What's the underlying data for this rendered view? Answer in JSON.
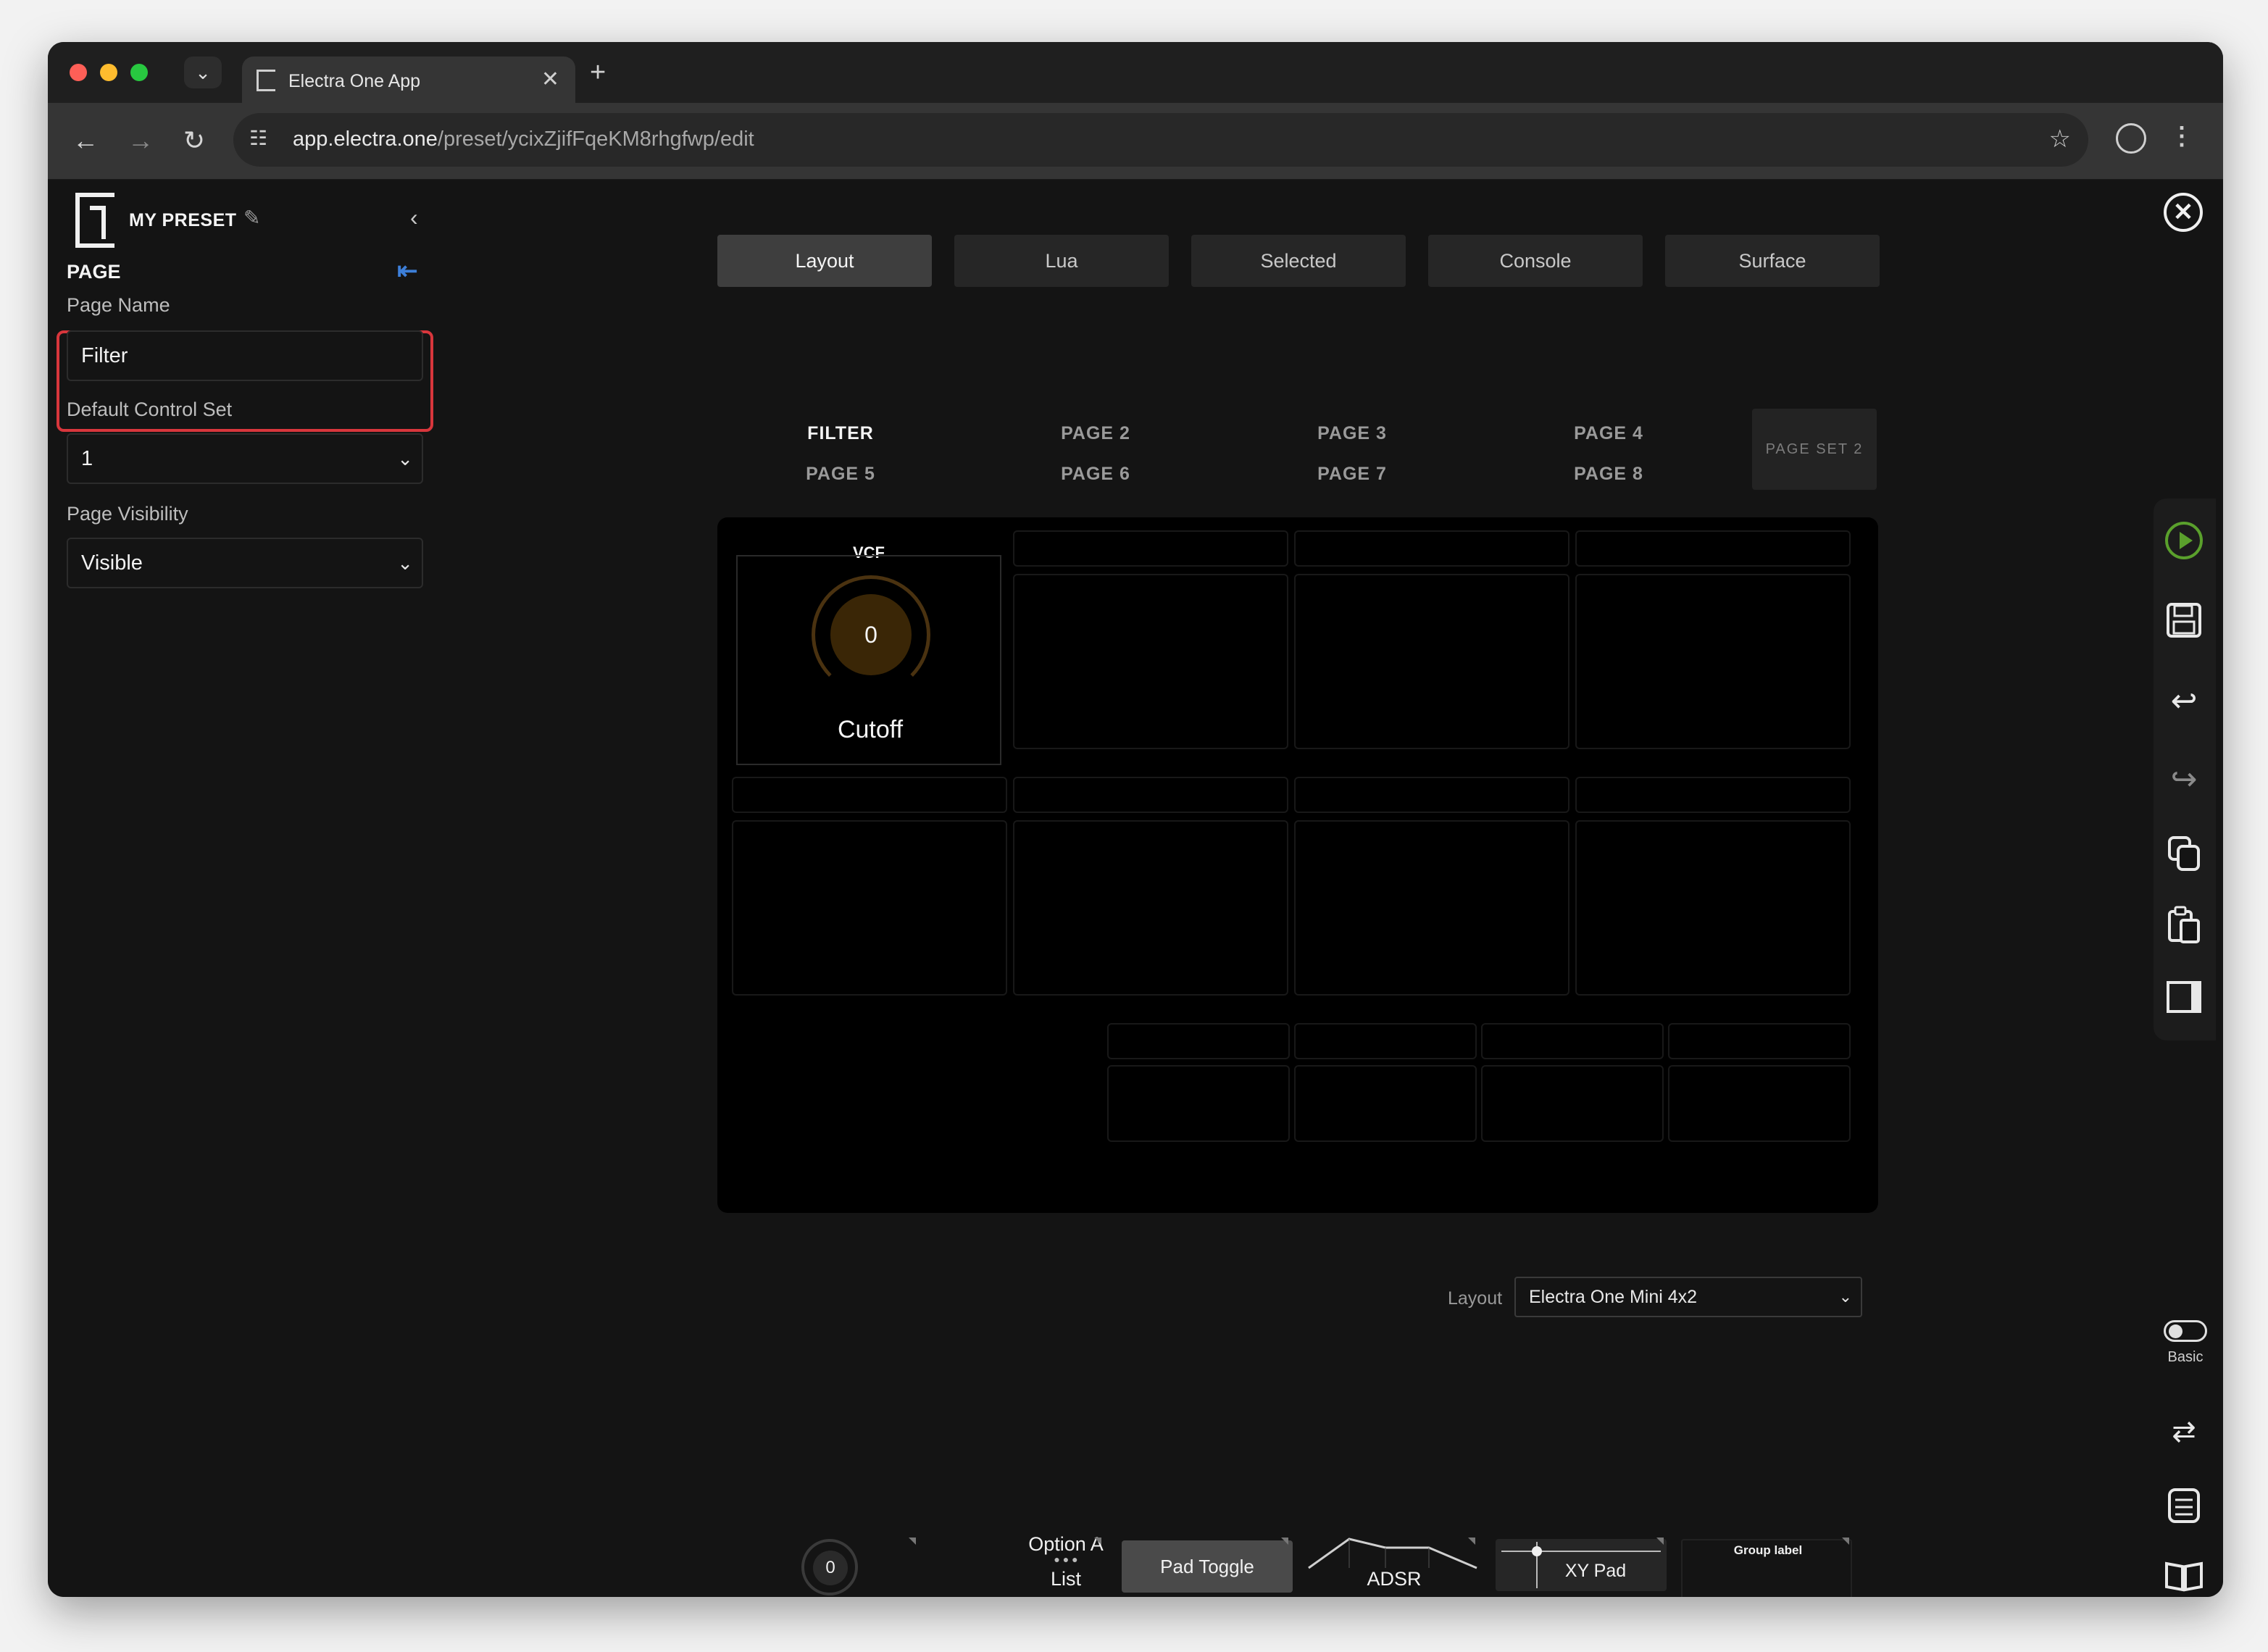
{
  "browser": {
    "tab_title": "Electra One App",
    "url_host": "app.electra.one",
    "url_path": "/preset/ycixZjifFqeKM8rhgfwp/edit"
  },
  "sidebar": {
    "preset_name": "MY PRESET",
    "section": "PAGE",
    "page_name_label": "Page Name",
    "page_name_value": "Filter",
    "control_set_label": "Default Control Set",
    "control_set_value": "1",
    "visibility_label": "Page Visibility",
    "visibility_value": "Visible"
  },
  "tabs": [
    "Layout",
    "Lua",
    "Selected",
    "Console",
    "Surface"
  ],
  "active_tab": "Layout",
  "pages": [
    "FILTER",
    "PAGE 2",
    "PAGE 3",
    "PAGE 4",
    "PAGE 5",
    "PAGE 6",
    "PAGE 7",
    "PAGE 8"
  ],
  "active_page": "FILTER",
  "page_set": "PAGE SET 2",
  "control": {
    "group": "VCF",
    "value": "0",
    "name": "Cutoff",
    "accent": "#4a3210"
  },
  "layout": {
    "label": "Layout",
    "value": "Electra One Mini 4x2"
  },
  "palette": {
    "knob_value": "0",
    "list_option": "Option A",
    "list_label": "List",
    "pad_label": "Pad Toggle",
    "adsr_label": "ADSR",
    "xy_label": "XY Pad",
    "group_label": "Group label"
  },
  "rail": {
    "icons": [
      "play-icon",
      "save-icon",
      "undo-icon",
      "redo-icon",
      "copy-icon",
      "paste-icon",
      "panel-icon"
    ],
    "toggle_label": "Basic",
    "bottom_icons": [
      "swap-icon",
      "calculator-icon",
      "book-icon"
    ]
  },
  "colors": {
    "background": "#141414",
    "highlight": "#d8363c",
    "accent_blue": "#3d7fd9",
    "play_green": "#5aa02c"
  }
}
